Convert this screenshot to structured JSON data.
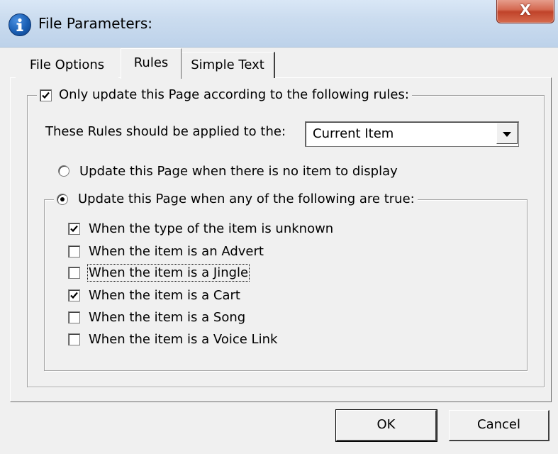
{
  "window": {
    "title": "File Parameters:",
    "close_label": "X",
    "icon": "info-icon"
  },
  "tabs": [
    {
      "label": "File Options",
      "selected": false
    },
    {
      "label": "Rules",
      "selected": true
    },
    {
      "label": "Simple Text",
      "selected": false
    }
  ],
  "rules": {
    "only_update": {
      "label": "Only update this Page according to the following rules:",
      "checked": true
    },
    "applied_to_label": "These Rules should be applied to the:",
    "applied_to_value": "Current Item",
    "radio_none": {
      "label": "Update this Page when there is no item to display",
      "selected": false
    },
    "radio_any": {
      "label": "Update this Page when any of the following are true:",
      "selected": true
    },
    "conditions": [
      {
        "label": "When the type of the item is unknown",
        "checked": true
      },
      {
        "label": "When the item is an Advert",
        "checked": false
      },
      {
        "label": "When the item is a Jingle",
        "checked": false,
        "focused": true
      },
      {
        "label": "When the item is a Cart",
        "checked": true
      },
      {
        "label": "When the item is a Song",
        "checked": false
      },
      {
        "label": "When the item is a Voice Link",
        "checked": false
      }
    ]
  },
  "buttons": {
    "ok": "OK",
    "cancel": "Cancel"
  }
}
